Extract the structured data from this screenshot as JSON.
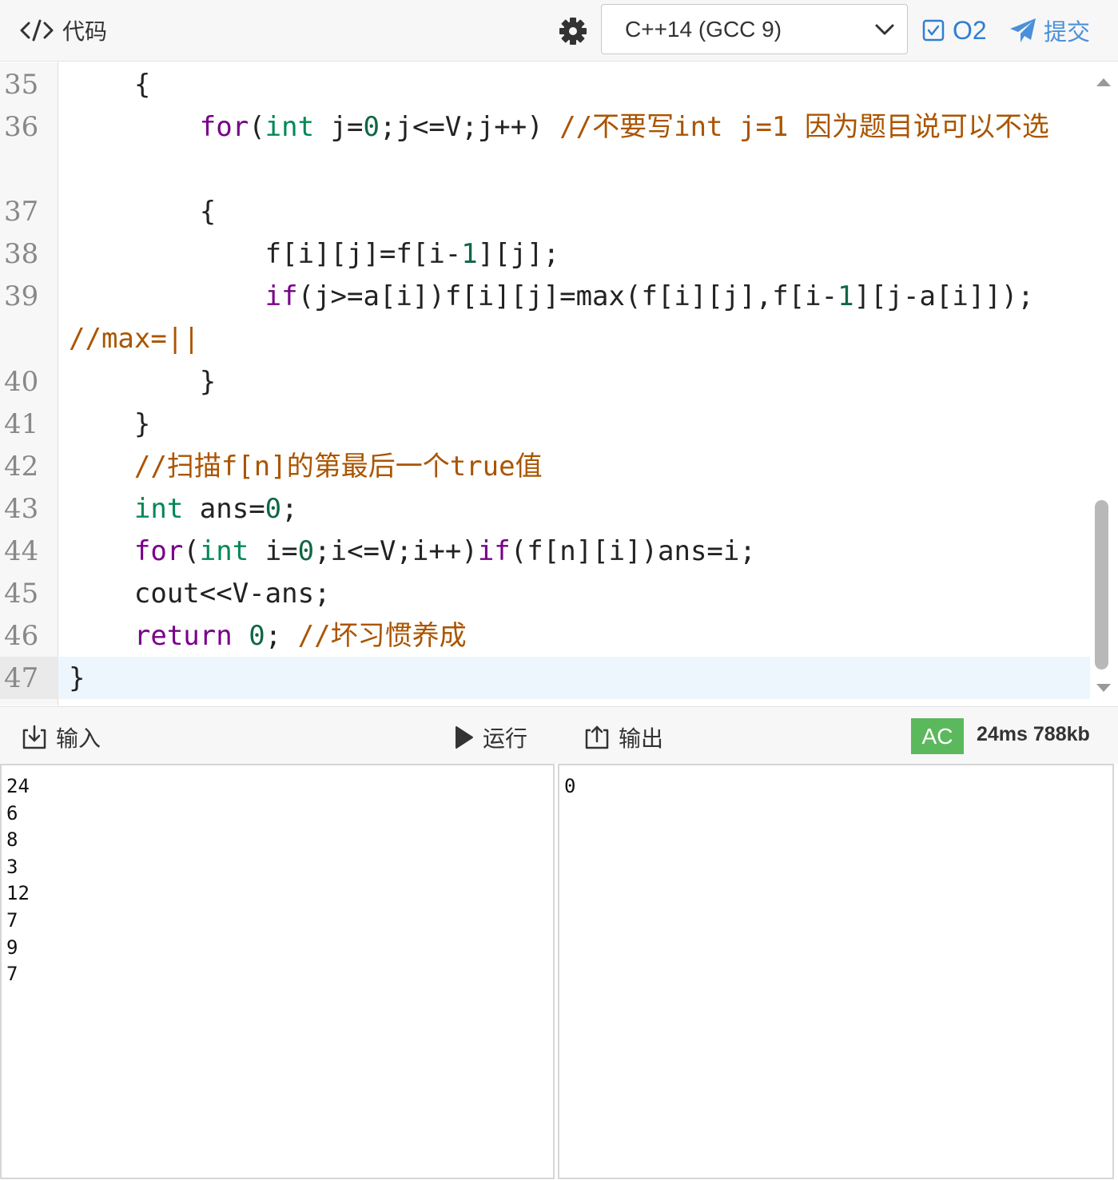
{
  "toolbar": {
    "title": "代码",
    "language": "C++14 (GCC 9)",
    "o2_label": "O2",
    "o2_checked": true,
    "submit_label": "提交"
  },
  "editor": {
    "active_line": "47",
    "lines": [
      {
        "no": "35",
        "text": "    {"
      },
      {
        "no": "36",
        "text": "        for(int j=0;j<=V;j++) //不要写int j=1 因为题目说可以不选"
      },
      {
        "no": "37",
        "text": "        {"
      },
      {
        "no": "38",
        "text": "            f[i][j]=f[i-1][j];"
      },
      {
        "no": "39",
        "text": "            if(j>=a[i])f[i][j]=max(f[i][j],f[i-1][j-a[i]]); //max=||"
      },
      {
        "no": "40",
        "text": "        }"
      },
      {
        "no": "41",
        "text": "    }"
      },
      {
        "no": "42",
        "text": "    //扫描f[n]的第最后一个true值"
      },
      {
        "no": "43",
        "text": "    int ans=0;"
      },
      {
        "no": "44",
        "text": "    for(int i=0;i<=V;i++)if(f[n][i])ans=i;"
      },
      {
        "no": "45",
        "text": "    cout<<V-ans;"
      },
      {
        "no": "46",
        "text": "    return 0; //坏习惯养成"
      },
      {
        "no": "47",
        "text": "}"
      }
    ]
  },
  "io": {
    "input_label": "输入",
    "run_label": "运行",
    "output_label": "输出",
    "status": "AC",
    "status_color": "#5cb85c",
    "stats": "24ms 788kb",
    "input_text": "24\n6\n8\n3\n12\n7\n9\n7",
    "output_text": "0"
  }
}
